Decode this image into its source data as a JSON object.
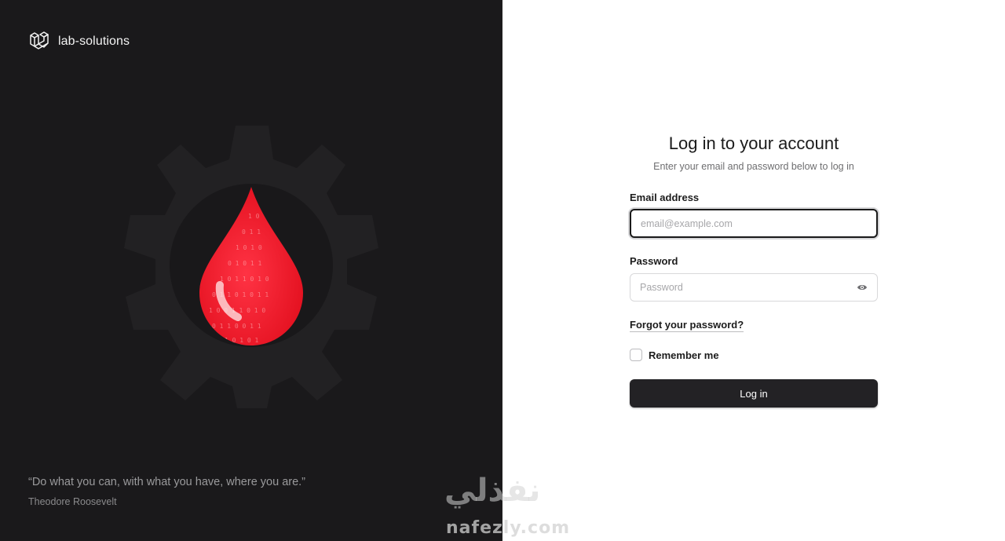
{
  "brand": {
    "name": "lab-solutions",
    "logo_icon": "laravel-logo-icon"
  },
  "hero": {
    "icon": "blood-drop-gear-icon",
    "accent": "#ff2a3a"
  },
  "quote": {
    "text": "“Do what you can, with what you have, where you are.”",
    "author": "Theodore Roosevelt"
  },
  "login": {
    "title": "Log in to your account",
    "subtitle": "Enter your email and password below to log in",
    "email_label": "Email address",
    "email_value": "",
    "email_placeholder": "email@example.com",
    "password_label": "Password",
    "password_value": "",
    "password_placeholder": "Password",
    "password_toggle_icon": "eye-icon",
    "forgot_link": "Forgot your password?",
    "remember_label": "Remember me",
    "remember_checked": false,
    "submit_label": "Log in"
  },
  "watermark": {
    "arabic": "نفذلي",
    "latin": "nafezly.com"
  },
  "colors": {
    "left_bg": "#1a191b",
    "button_bg": "#232225",
    "text": "#1c1c1c"
  }
}
